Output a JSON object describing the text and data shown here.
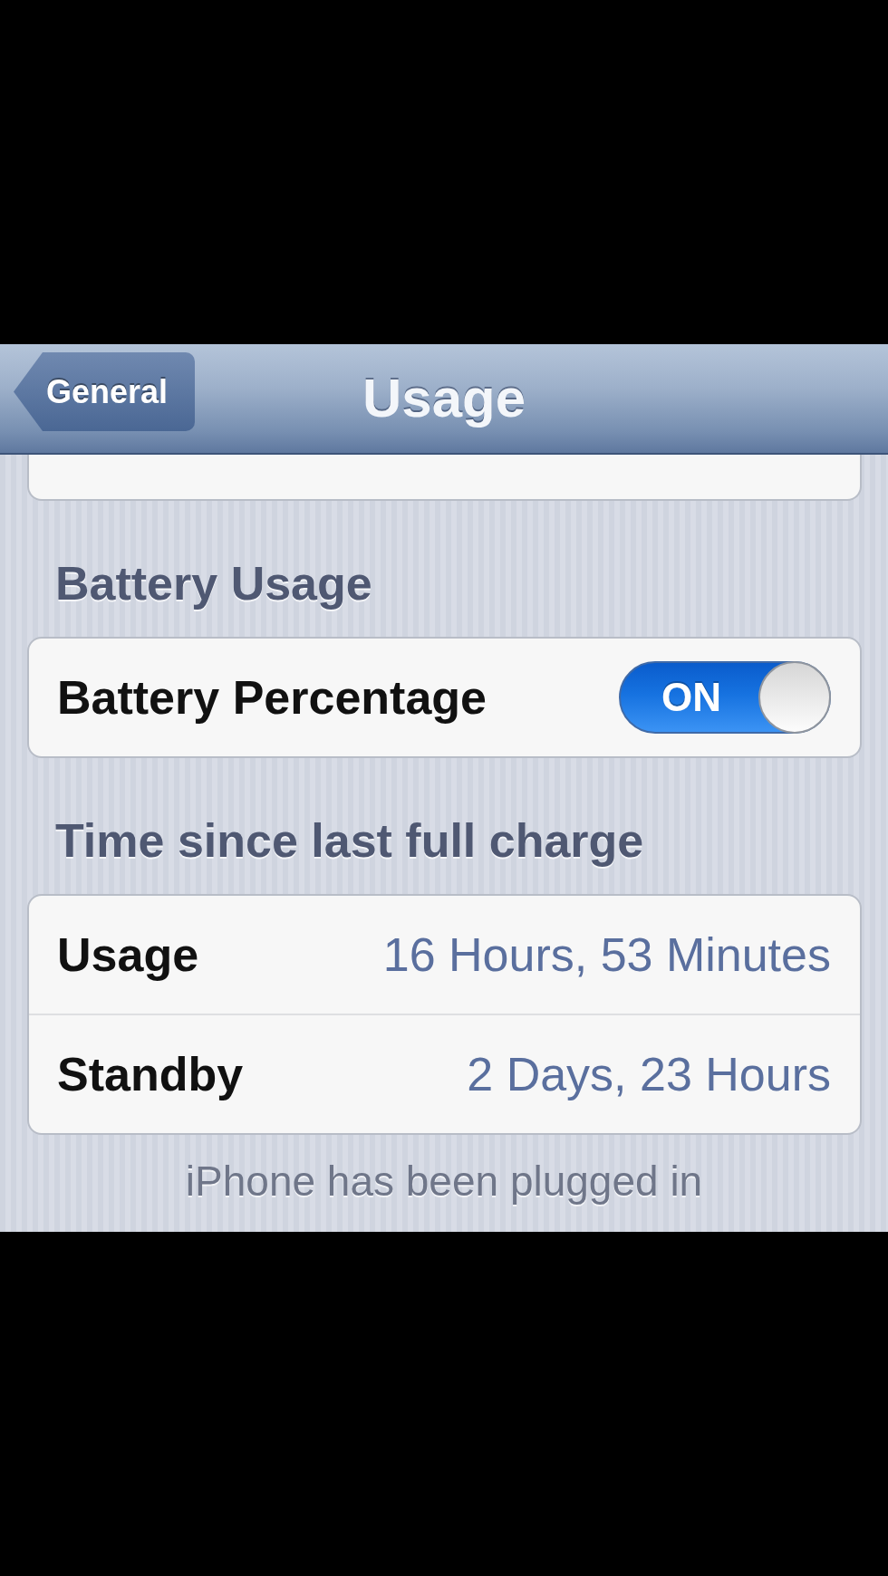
{
  "nav_bar": {
    "back_button": "General",
    "title": "Usage"
  },
  "sections": [
    {
      "header": "Battery Usage",
      "rows": [
        {
          "kind": "switch",
          "label": "Battery Percentage",
          "switch_label": "ON",
          "on": true
        }
      ]
    },
    {
      "header": "Time since last full charge",
      "rows": [
        {
          "kind": "value",
          "label": "Usage",
          "value": "16 Hours, 53 Minutes"
        },
        {
          "kind": "value",
          "label": "Standby",
          "value": "2 Days, 23 Hours"
        }
      ],
      "footer": "iPhone has been plugged in"
    }
  ]
}
